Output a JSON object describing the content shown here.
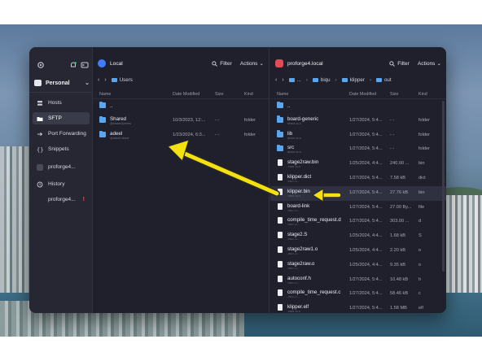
{
  "app": {
    "sidebar": {
      "vault_label": "Personal",
      "items": [
        {
          "label": "Hosts",
          "icon": "hosts-icon",
          "active": false
        },
        {
          "label": "SFTP",
          "icon": "folder-icon",
          "active": true
        },
        {
          "label": "Port Forwarding",
          "icon": "port-forwarding-icon",
          "active": false
        },
        {
          "label": "Snippets",
          "icon": "snippets-icon",
          "active": false
        },
        {
          "label": "proforge4...",
          "icon": "host-icon",
          "active": false
        },
        {
          "label": "History",
          "icon": "history-icon",
          "active": false
        },
        {
          "label": "proforge4...",
          "icon": "host-icon",
          "active": false,
          "warning": "!"
        }
      ]
    },
    "left_pane": {
      "title": "Local",
      "filter_label": "Filter",
      "actions_label": "Actions",
      "path": [
        "Users"
      ],
      "columns": {
        "name": "Name",
        "date": "Date Modified",
        "size": "Size",
        "kind": "Kind"
      },
      "rows": [
        {
          "name": "..",
          "sub": "",
          "date": "",
          "size": "",
          "kind": "",
          "type": "folder"
        },
        {
          "name": "Shared",
          "sub": "@sharedperms",
          "date": "10/3/2023, 12:...",
          "size": "- -",
          "kind": "folder",
          "type": "folder"
        },
        {
          "name": "adeel",
          "sub": "@adeel-drwxr",
          "date": "1/23/2024, 6:3...",
          "size": "- -",
          "kind": "folder",
          "type": "folder"
        }
      ]
    },
    "right_pane": {
      "title": "proforge4.local",
      "filter_label": "Filter",
      "actions_label": "Actions",
      "path": [
        "...",
        "biqu",
        "klipper",
        "out"
      ],
      "columns": {
        "name": "Name",
        "date": "Date Modified",
        "size": "Size",
        "kind": "Kind"
      },
      "rows": [
        {
          "name": "..",
          "sub": "",
          "date": "",
          "size": "",
          "kind": "",
          "type": "folder"
        },
        {
          "name": "board-generic",
          "sub": "drwxr-xr-x",
          "date": "1/27/2024, 5:4...",
          "size": "- -",
          "kind": "folder",
          "type": "folder"
        },
        {
          "name": "lib",
          "sub": "drwxr-xr-x",
          "date": "1/27/2024, 5:4...",
          "size": "- -",
          "kind": "folder",
          "type": "folder"
        },
        {
          "name": "src",
          "sub": "drwxr-xr-x",
          "date": "1/27/2024, 5:4...",
          "size": "- -",
          "kind": "folder",
          "type": "folder"
        },
        {
          "name": "stage2raw.bin",
          "sub": "-rwxr-xr-x",
          "date": "1/25/2024, 4:4...",
          "size": "240.00 ...",
          "kind": "bin",
          "type": "file"
        },
        {
          "name": "klipper.dict",
          "sub": "-rw-r--r--",
          "date": "1/27/2024, 5:4...",
          "size": "7.58 kB",
          "kind": "dict",
          "type": "file"
        },
        {
          "name": "klipper.bin",
          "sub": "-rwxr-xr-x",
          "date": "1/27/2024, 5:4...",
          "size": "27.76 kB",
          "kind": "bin",
          "type": "file",
          "selected": true
        },
        {
          "name": "board-link",
          "sub": "-rw-r--r--",
          "date": "1/27/2024, 5:4...",
          "size": "27.00 By...",
          "kind": "file",
          "type": "file"
        },
        {
          "name": "compile_time_request.d",
          "sub": "-rw-r--r--",
          "date": "1/27/2024, 5:4...",
          "size": "303.00 ...",
          "kind": "d",
          "type": "file"
        },
        {
          "name": "stage2.S",
          "sub": "-rw-r--r--",
          "date": "1/25/2024, 4:4...",
          "size": "1.68 kB",
          "kind": "S",
          "type": "file"
        },
        {
          "name": "stage2raw1.o",
          "sub": "-rw-r--r--",
          "date": "1/25/2024, 4:4...",
          "size": "2.20 kB",
          "kind": "o",
          "type": "file"
        },
        {
          "name": "stage2raw.o",
          "sub": "-rw-r--r--",
          "date": "1/25/2024, 4:4...",
          "size": "9.35 kB",
          "kind": "o",
          "type": "file"
        },
        {
          "name": "autoconf.h",
          "sub": "-rw-r--r--",
          "date": "1/27/2024, 5:4...",
          "size": "10.48 kB",
          "kind": "h",
          "type": "file"
        },
        {
          "name": "compile_time_request.c",
          "sub": "-rw-r--r--",
          "date": "1/27/2024, 5:4...",
          "size": "58.46 kB",
          "kind": "c",
          "type": "file"
        },
        {
          "name": "klipper.elf",
          "sub": "-rwxr-xr-x",
          "date": "1/27/2024, 5:4...",
          "size": "1.58 MB",
          "kind": "elf",
          "type": "file"
        }
      ]
    }
  },
  "colors": {
    "annotation_arrow": "#f4e10f",
    "accent_blue": "#5aa6ef",
    "remote_badge": "#e54b55",
    "warning": "#ff4f59"
  }
}
